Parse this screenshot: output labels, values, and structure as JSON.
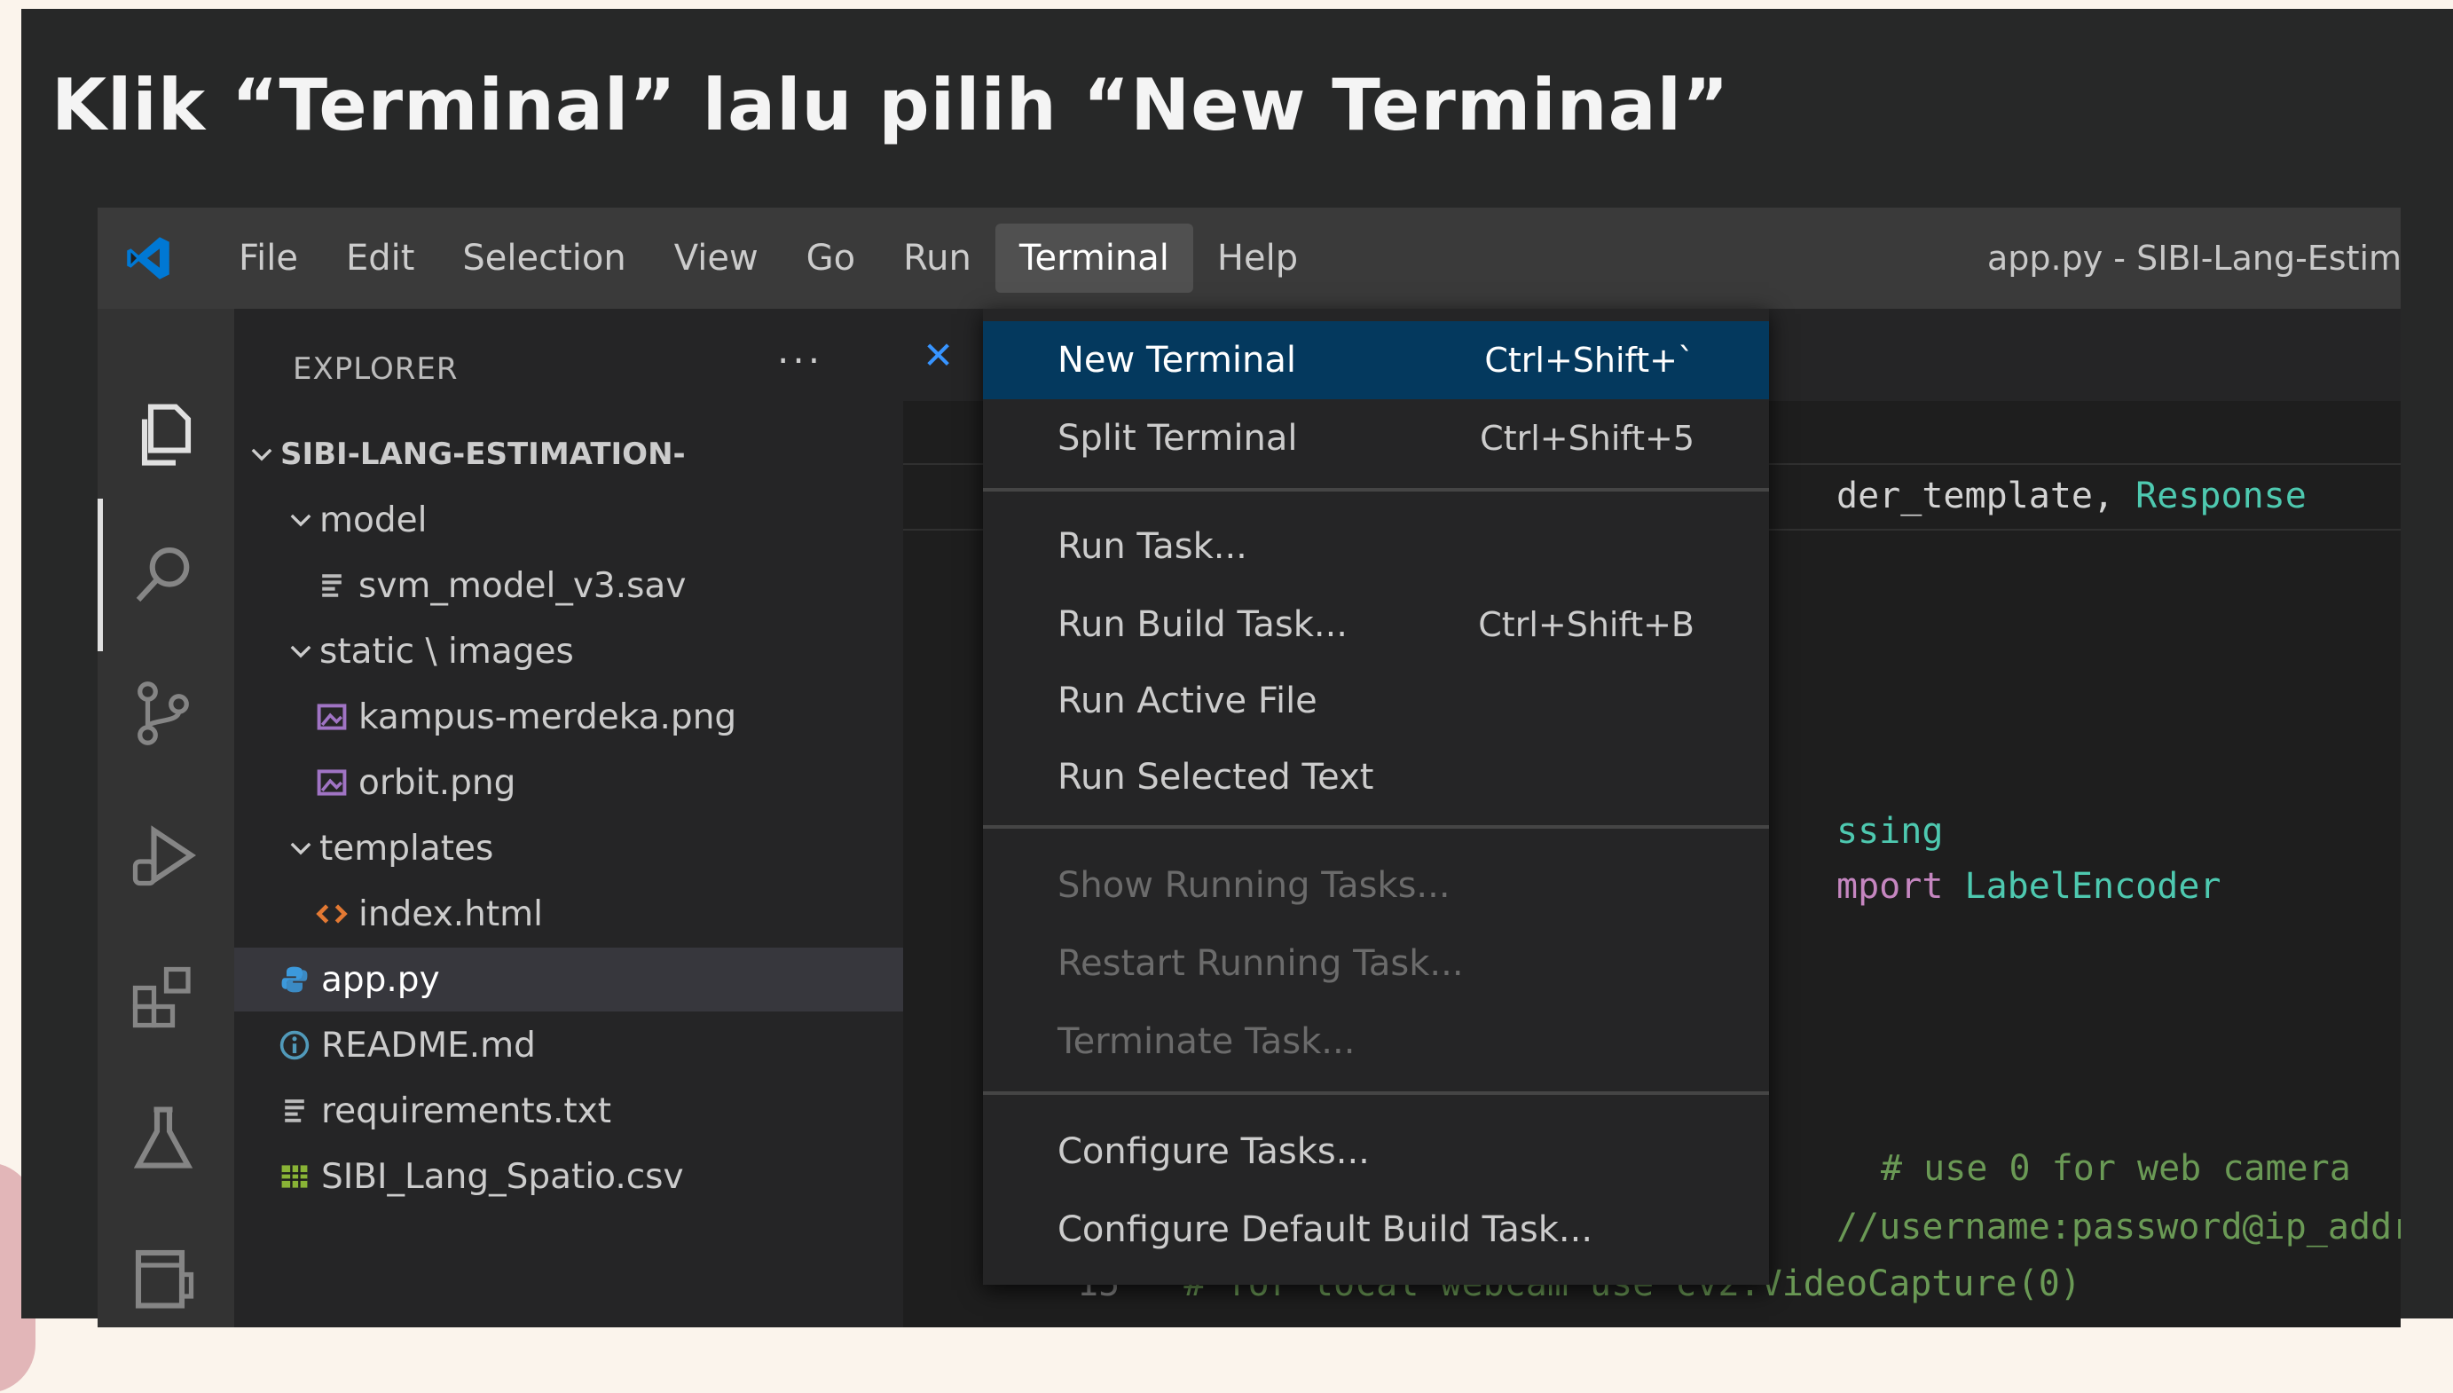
{
  "slide": {
    "title": "Klik “Terminal” lalu pilih “New Terminal”"
  },
  "menubar": {
    "items": [
      "File",
      "Edit",
      "Selection",
      "View",
      "Go",
      "Run",
      "Terminal",
      "Help"
    ],
    "active": "Terminal"
  },
  "window_title": "app.py - SIBI-Lang-Estimat",
  "explorer": {
    "title": "EXPLORER",
    "more": "···",
    "tree": [
      {
        "label": "SIBI-LANG-ESTIMATION-",
        "type": "root",
        "expanded": true
      },
      {
        "label": "model",
        "type": "folder",
        "expanded": true
      },
      {
        "label": "svm_model_v3.sav",
        "type": "file-lines"
      },
      {
        "label": "static \\ images",
        "type": "folder",
        "expanded": true
      },
      {
        "label": "kampus-merdeka.png",
        "type": "image"
      },
      {
        "label": "orbit.png",
        "type": "image"
      },
      {
        "label": "templates",
        "type": "folder",
        "expanded": true
      },
      {
        "label": "index.html",
        "type": "html"
      },
      {
        "label": "app.py",
        "type": "python",
        "selected": true
      },
      {
        "label": "README.md",
        "type": "info"
      },
      {
        "label": "requirements.txt",
        "type": "file-lines"
      },
      {
        "label": "SIBI_Lang_Spatio.csv",
        "type": "csv"
      }
    ]
  },
  "code_fragments": {
    "line1_a": "der_template, ",
    "line1_b": "Response",
    "line2": "ssing",
    "line3_a": "mport ",
    "line3_b": "LabelEncoder",
    "line4": "# use 0 for web camera",
    "line5": "//username:password@ip_addre",
    "line6_num": "15",
    "line6": "# for local webcam use cv2.VideoCapture(0)"
  },
  "terminal_menu": {
    "groups": [
      [
        {
          "label": "New Terminal",
          "shortcut": "Ctrl+Shift+`",
          "highlighted": true
        },
        {
          "label": "Split Terminal",
          "shortcut": "Ctrl+Shift+5"
        }
      ],
      [
        {
          "label": "Run Task...",
          "shortcut": ""
        },
        {
          "label": "Run Build Task...",
          "shortcut": "Ctrl+Shift+B"
        },
        {
          "label": "Run Active File",
          "shortcut": ""
        },
        {
          "label": "Run Selected Text",
          "shortcut": ""
        }
      ],
      [
        {
          "label": "Show Running Tasks...",
          "shortcut": "",
          "disabled": true
        },
        {
          "label": "Restart Running Task...",
          "shortcut": "",
          "disabled": true
        },
        {
          "label": "Terminate Task...",
          "shortcut": "",
          "disabled": true
        }
      ],
      [
        {
          "label": "Configure Tasks...",
          "shortcut": ""
        },
        {
          "label": "Configure Default Build Task...",
          "shortcut": ""
        }
      ]
    ]
  },
  "colors": {
    "accent_highlight": "#04395e",
    "vscode_blue": "#0078d4",
    "slide_bg": "#272828"
  },
  "icons": {
    "activity_bar": [
      "explorer-files-icon",
      "search-icon",
      "source-control-icon",
      "run-debug-icon",
      "extensions-icon",
      "testing-flask-icon",
      "remote-explorer-icon"
    ]
  }
}
